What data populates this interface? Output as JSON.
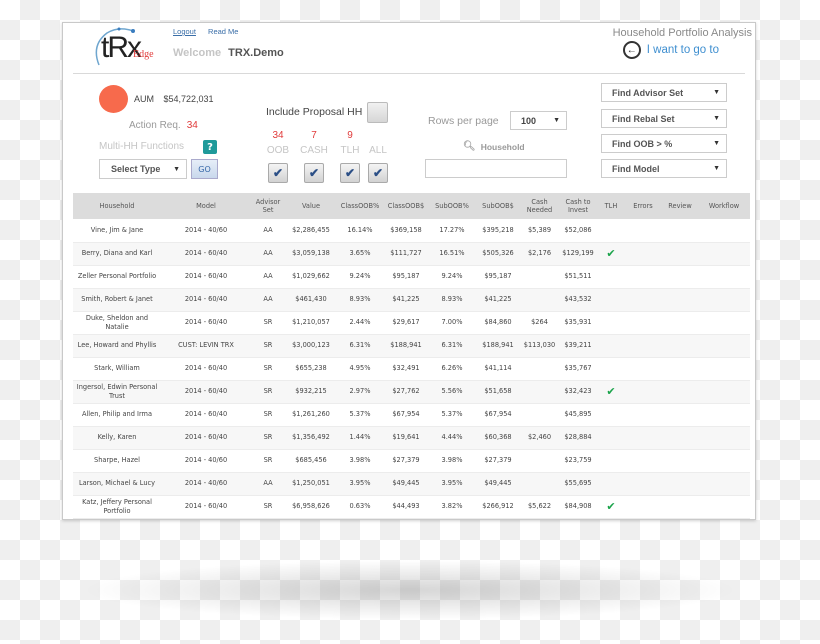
{
  "header": {
    "logo_text": "tRx",
    "logo_sub": "Edge",
    "links": [
      "Logout",
      "Read Me"
    ],
    "welcome_label": "Welcome",
    "username": "TRX.Demo",
    "app_title": "Household Portfolio Analysis",
    "goto_label": "I want to go to"
  },
  "summary": {
    "aum_label": "AUM",
    "aum_value": "$54,722,031",
    "action_label": "Action Req.",
    "action_count": "34",
    "multi_label": "Multi-HH Functions",
    "help_glyph": "?",
    "select_type": "Select Type",
    "go_label": "GO",
    "status_color": "#f76a4c"
  },
  "filters": {
    "proposal_label": "Include Proposal HH",
    "proposal_checked": false,
    "items": [
      {
        "count": "34",
        "label": "OOB",
        "checked": true
      },
      {
        "count": "7",
        "label": "CASH",
        "checked": true
      },
      {
        "count": "9",
        "label": "TLH",
        "checked": true
      },
      {
        "count": "",
        "label": "ALL",
        "checked": true
      }
    ]
  },
  "paging": {
    "rows_label": "Rows per page",
    "rows_value": "100",
    "search_label": "Household",
    "search_value": ""
  },
  "finders": [
    "Find Advisor Set",
    "Find Rebal Set",
    "Find OOB > %",
    "Find Model"
  ],
  "table": {
    "columns": [
      "Household",
      "Model",
      "Advisor Set",
      "Value",
      "ClassOOB%",
      "ClassOOB$",
      "SubOOB%",
      "SubOOB$",
      "Cash Needed",
      "Cash to Invest",
      "TLH",
      "Errors",
      "Review",
      "Workflow"
    ],
    "rows": [
      [
        "Vine, Jim & Jane",
        "2014 - 40/60",
        "AA",
        "$2,286,455",
        "16.14%",
        "$369,158",
        "17.27%",
        "$395,218",
        "$5,389",
        "$52,086",
        "",
        "",
        "",
        ""
      ],
      [
        "Berry, Diana and Karl",
        "2014 - 60/40",
        "AA",
        "$3,059,138",
        "3.65%",
        "$111,727",
        "16.51%",
        "$505,326",
        "$2,176",
        "$129,199",
        "✔",
        "",
        "",
        ""
      ],
      [
        "Zeller Personal Portfolio",
        "2014 - 60/40",
        "AA",
        "$1,029,662",
        "9.24%",
        "$95,187",
        "9.24%",
        "$95,187",
        "",
        "$51,511",
        "",
        "",
        "",
        ""
      ],
      [
        "Smith, Robert & Janet",
        "2014 - 60/40",
        "AA",
        "$461,430",
        "8.93%",
        "$41,225",
        "8.93%",
        "$41,225",
        "",
        "$43,532",
        "",
        "",
        "",
        ""
      ],
      [
        "Duke, Sheldon and Natalie",
        "2014 - 60/40",
        "SR",
        "$1,210,057",
        "2.44%",
        "$29,617",
        "7.00%",
        "$84,860",
        "$264",
        "$35,931",
        "",
        "",
        "",
        ""
      ],
      [
        "Lee, Howard and Phyllis",
        "CUST: LEVIN TRX",
        "SR",
        "$3,000,123",
        "6.31%",
        "$188,941",
        "6.31%",
        "$188,941",
        "$113,030",
        "$39,211",
        "",
        "",
        "",
        ""
      ],
      [
        "Stark, William",
        "2014 - 60/40",
        "SR",
        "$655,238",
        "4.95%",
        "$32,491",
        "6.26%",
        "$41,114",
        "",
        "$35,767",
        "",
        "",
        "",
        ""
      ],
      [
        "Ingersol, Edwin Personal Trust",
        "2014 - 60/40",
        "SR",
        "$932,215",
        "2.97%",
        "$27,762",
        "5.56%",
        "$51,658",
        "",
        "$32,423",
        "✔",
        "",
        "",
        ""
      ],
      [
        "Allen, Philip and Irma",
        "2014 - 60/40",
        "SR",
        "$1,261,260",
        "5.37%",
        "$67,954",
        "5.37%",
        "$67,954",
        "",
        "$45,895",
        "",
        "",
        "",
        ""
      ],
      [
        "Kelly, Karen",
        "2014 - 60/40",
        "SR",
        "$1,356,492",
        "1.44%",
        "$19,641",
        "4.44%",
        "$60,368",
        "$2,460",
        "$28,884",
        "",
        "",
        "",
        ""
      ],
      [
        "Sharpe, Hazel",
        "2014 - 40/60",
        "SR",
        "$685,456",
        "3.98%",
        "$27,379",
        "3.98%",
        "$27,379",
        "",
        "$23,759",
        "",
        "",
        "",
        ""
      ],
      [
        "Larson, Michael & Lucy",
        "2014 - 40/60",
        "AA",
        "$1,250,051",
        "3.95%",
        "$49,445",
        "3.95%",
        "$49,445",
        "",
        "$55,695",
        "",
        "",
        "",
        ""
      ],
      [
        "Katz, Jeffery Personal Portfolio",
        "2014 - 60/40",
        "SR",
        "$6,958,626",
        "0.63%",
        "$44,493",
        "3.82%",
        "$266,912",
        "$5,622",
        "$84,908",
        "✔",
        "",
        "",
        ""
      ]
    ]
  }
}
